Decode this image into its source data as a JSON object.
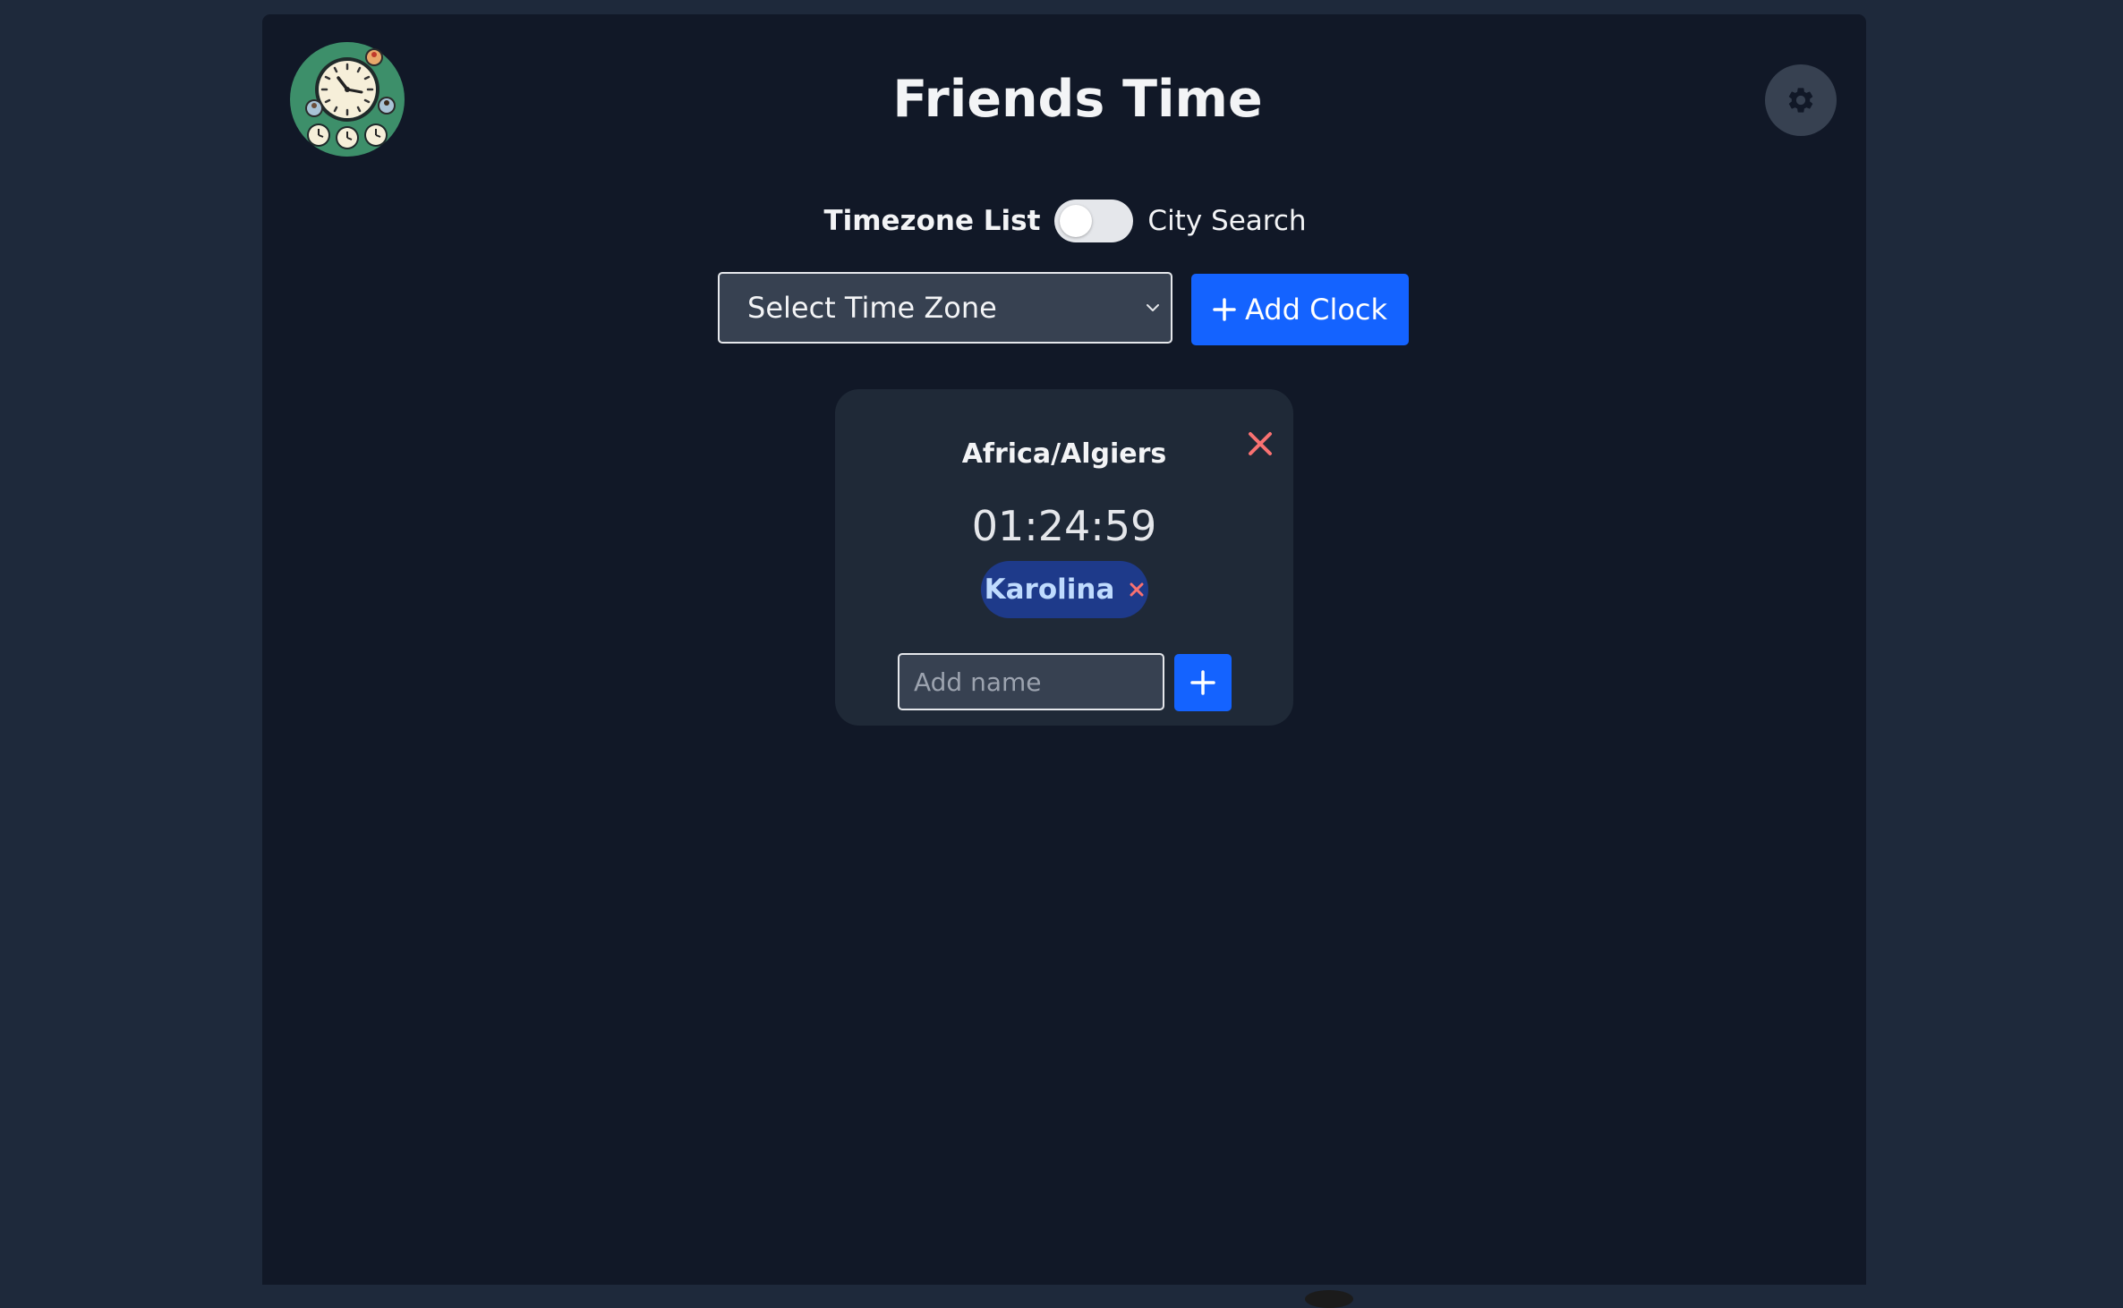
{
  "header": {
    "title": "Friends Time",
    "logo_icon": "world-clock-logo-icon",
    "settings_icon": "gear-icon"
  },
  "mode_toggle": {
    "left_label": "Timezone List",
    "right_label": "City Search",
    "selected": "Timezone List"
  },
  "controls": {
    "timezone_select_value": "Select Time Zone",
    "add_clock_label": "Add Clock",
    "add_clock_icon": "plus-icon"
  },
  "clocks": [
    {
      "timezone": "Africa/Algiers",
      "time": "01:24:59",
      "friends": [
        "Karolina"
      ],
      "add_name_placeholder": "Add name"
    }
  ],
  "colors": {
    "page_bg": "#1e293b",
    "app_bg": "#111827",
    "card_bg": "#1f2937",
    "primary": "#1463ff",
    "danger": "#f87171",
    "chip_bg": "#1e3a8a",
    "chip_text": "#bfdbfe"
  }
}
